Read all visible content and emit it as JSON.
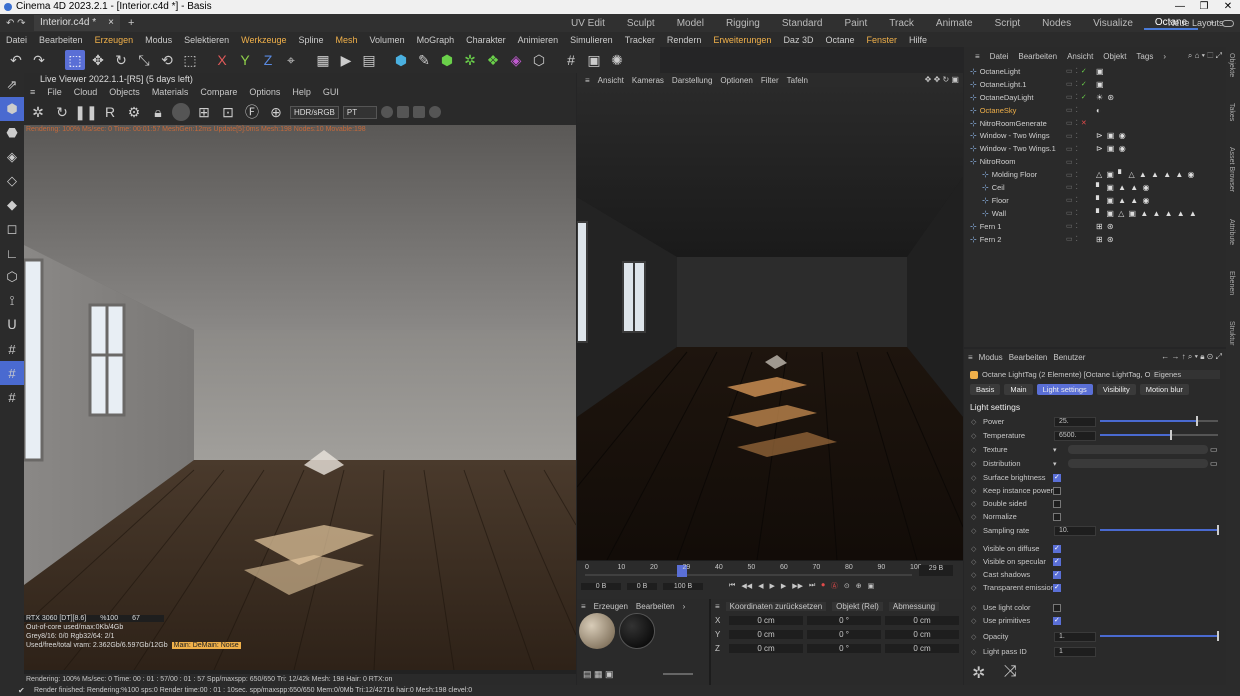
{
  "window": {
    "title": "Cinema 4D 2023.2.1 - [Interior.c4d *] - Basis",
    "controls": [
      "—",
      "❐",
      "✕"
    ]
  },
  "doc_tab": {
    "label": "Interior.c4d *",
    "close": "×",
    "add": "+"
  },
  "layouts": {
    "items": [
      "UV Edit",
      "Sculpt",
      "Model",
      "Rigging",
      "Standard",
      "Paint",
      "Track",
      "Animate",
      "Script",
      "Nodes",
      "Visualize",
      "Octane"
    ],
    "active": "Octane",
    "add": "+",
    "new_layouts": "Neue Layouts"
  },
  "menubar": [
    "Datei",
    "Bearbeiten",
    "Erzeugen",
    "Modus",
    "Selektieren",
    "Werkzeuge",
    "Spline",
    "Mesh",
    "Volumen",
    "MoGraph",
    "Charakter",
    "Animieren",
    "Simulieren",
    "Tracker",
    "Rendern",
    "Erweiterungen",
    "Daz 3D",
    "Octane",
    "Fenster",
    "Hilfe"
  ],
  "menubar_highlight": [
    "Erzeugen",
    "Werkzeuge",
    "Mesh",
    "Erweiterungen",
    "Fenster"
  ],
  "live_viewer": {
    "title": "Live Viewer 2022.1.1-[R5] (5 days left)",
    "menu": [
      "File",
      "Cloud",
      "Objects",
      "Materials",
      "Compare",
      "Options",
      "Help",
      "GUI"
    ],
    "hdr": "HDR/sRGB",
    "kernel": "PT",
    "overlay": "Rendering: 100% Ms/sec: 0 Time: 00:01:57 MeshGen:12ms Update[5]:0ms Mesh:198 Nodes:10 Movable:198",
    "gpu": "RTX 3060 [DT][8.6]",
    "gpu_pct": "%100",
    "gpu_temp": "67",
    "stats": [
      "Out-of-core used/max:0Kb/4Gb",
      "Grey8/16: 0/0      Rgb32/64: 2/1",
      "Used/free/total vram: 2.362Gb/6.597Gb/12Gb"
    ],
    "badge": "Main: DeMain: Noise",
    "status": "Rendering: 100%  Ms/sec: 0   Time: 00 : 01 : 57/00 : 01 : 57  Spp/maxspp: 650/650   Tri: 12/42k   Mesh: 198   Hair: 0   RTX:on"
  },
  "viewport": {
    "menu": [
      "Ansicht",
      "Kameras",
      "Darstellung",
      "Optionen",
      "Filter",
      "Tafeln"
    ]
  },
  "timeline": {
    "ticks": [
      "0",
      "10",
      "20",
      "29",
      "40",
      "50",
      "60",
      "70",
      "80",
      "90",
      "100"
    ],
    "current": "29 B",
    "start": "0 B",
    "start2": "0 B",
    "end": "100 B"
  },
  "materials": {
    "menu": [
      "Erzeugen",
      "Bearbeiten"
    ]
  },
  "coords": {
    "reset": "Koordinaten zurücksetzen",
    "mode": "Objekt (Rel)",
    "size": "Abmessung",
    "rows": [
      {
        "axis": "X",
        "p": "0 cm",
        "r": "0 °",
        "s": "0 cm"
      },
      {
        "axis": "Y",
        "p": "0 cm",
        "r": "0 °",
        "s": "0 cm"
      },
      {
        "axis": "Z",
        "p": "0 cm",
        "r": "0 °",
        "s": "0 cm"
      }
    ]
  },
  "object_manager": {
    "menu": [
      "Datei",
      "Bearbeiten",
      "Ansicht",
      "Objekt",
      "Tags"
    ],
    "objects": [
      {
        "name": "OctaneLight",
        "indent": 0,
        "color": "#d0d0d0"
      },
      {
        "name": "OctaneLight.1",
        "indent": 0,
        "color": "#d0d0d0"
      },
      {
        "name": "OctaneDayLight",
        "indent": 0,
        "color": "#d0d0d0"
      },
      {
        "name": "OctaneSky",
        "indent": 0,
        "color": "#f0b04a"
      },
      {
        "name": "NitroRoomGenerate",
        "indent": 0,
        "color": "#d0d0d0"
      },
      {
        "name": "Window - Two Wings",
        "indent": 0,
        "color": "#d0d0d0"
      },
      {
        "name": "Window - Two Wings.1",
        "indent": 0,
        "color": "#d0d0d0"
      },
      {
        "name": "NitroRoom",
        "indent": 0,
        "color": "#d0d0d0"
      },
      {
        "name": "Molding Floor",
        "indent": 1,
        "color": "#d0d0d0"
      },
      {
        "name": "Ceil",
        "indent": 1,
        "color": "#d0d0d0"
      },
      {
        "name": "Floor",
        "indent": 1,
        "color": "#d0d0d0"
      },
      {
        "name": "Wall",
        "indent": 1,
        "color": "#d0d0d0"
      },
      {
        "name": "Fern 1",
        "indent": 0,
        "color": "#d0d0d0"
      },
      {
        "name": "Fern 2",
        "indent": 0,
        "color": "#d0d0d0"
      }
    ]
  },
  "attributes": {
    "menu": [
      "Modus",
      "Bearbeiten",
      "Benutzer"
    ],
    "header": "Octane LightTag (2 Elemente) [Octane LightTag, Oc",
    "header_select": "Eigenes",
    "tabs": [
      "Basis",
      "Main",
      "Light settings",
      "Visibility",
      "Motion blur"
    ],
    "active_tab": "Light settings",
    "section": "Light settings",
    "fields": [
      {
        "label": "Power",
        "value": "25.",
        "slider": 0.82
      },
      {
        "label": "Temperature",
        "value": "6500.",
        "slider": 0.6
      },
      {
        "label": "Texture",
        "value": ""
      },
      {
        "label": "Distribution",
        "value": ""
      },
      {
        "label": "Surface brightness",
        "check": true
      },
      {
        "label": "Keep instance power",
        "check": false
      },
      {
        "label": "Double sided",
        "check": false
      },
      {
        "label": "Normalize",
        "check": false
      },
      {
        "label": "Sampling rate",
        "value": "10.",
        "slider": 1.0
      },
      {
        "label": "Visible on diffuse",
        "check": true
      },
      {
        "label": "Visible on specular",
        "check": true
      },
      {
        "label": "Cast shadows",
        "check": true
      },
      {
        "label": "Transparent emission",
        "check": true
      },
      {
        "label": "Use light color",
        "check": false
      },
      {
        "label": "Use primitives",
        "check": true
      },
      {
        "label": "Opacity",
        "value": "1.",
        "slider": 1.0
      },
      {
        "label": "Light pass ID",
        "value": "1"
      }
    ]
  },
  "right_strip": [
    "Objekte",
    "Takes",
    "Asset Browser",
    "Attribute",
    "Ebenen",
    "Struktur"
  ],
  "statusbar": "Render finished: Rendering:%100 sps:0 Render time:00 : 01 : 10sec. spp/maxspp:650/650 Mem:0/0Mb Tri:12/42716 hair:0 Mesh:198 clevel:0"
}
